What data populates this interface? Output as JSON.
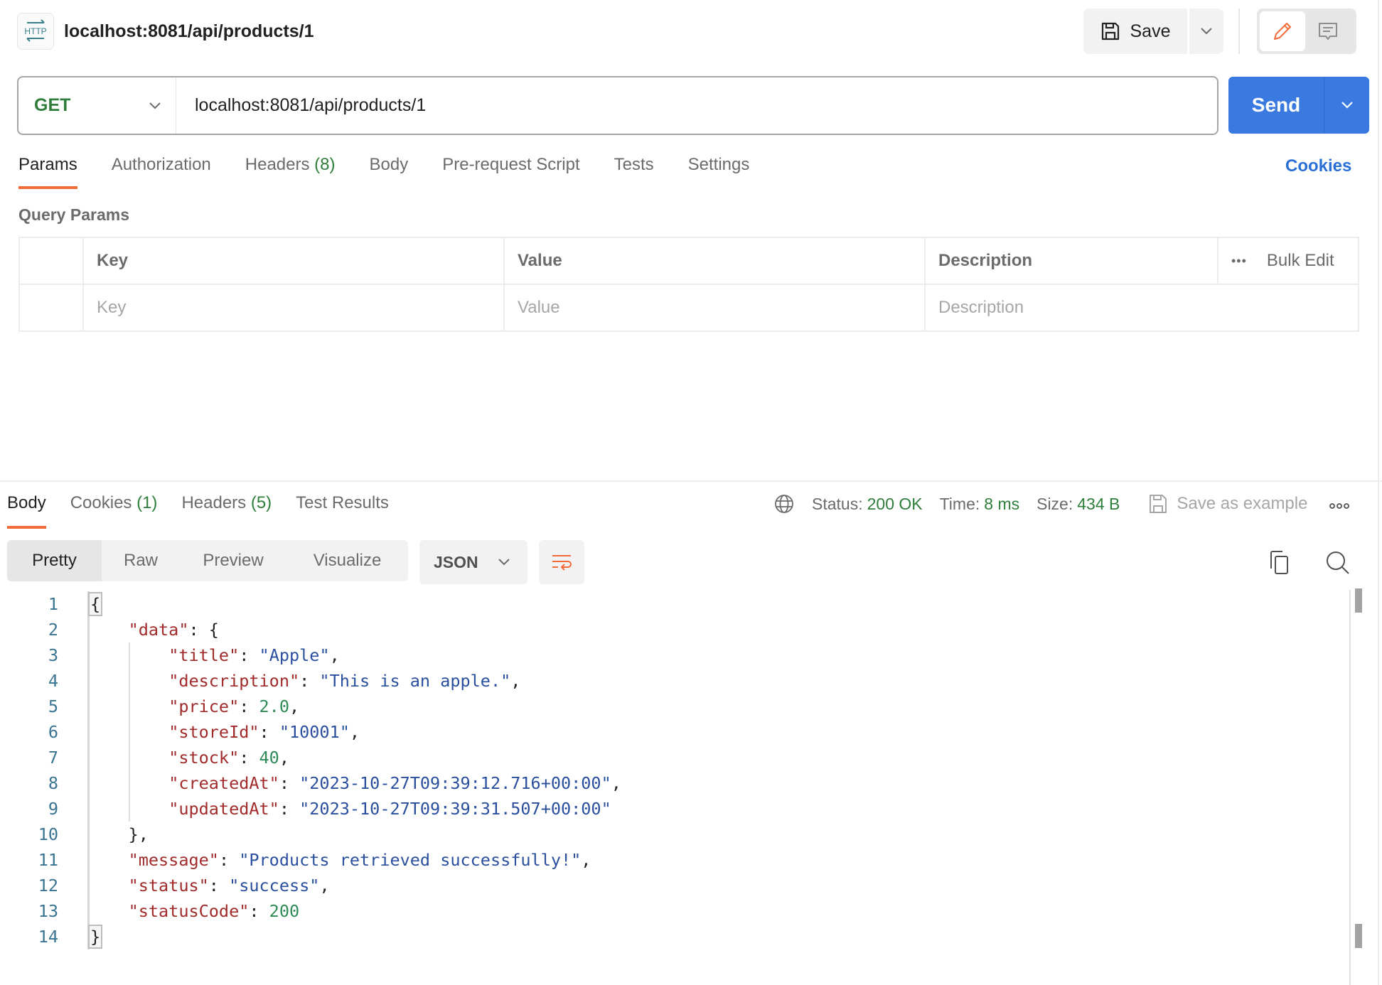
{
  "header": {
    "icon_label": "HTTP",
    "title": "localhost:8081/api/products/1",
    "save_label": "Save"
  },
  "request": {
    "method": "GET",
    "url": "localhost:8081/api/products/1",
    "send_label": "Send",
    "tabs": [
      {
        "label": "Params",
        "count": ""
      },
      {
        "label": "Authorization",
        "count": ""
      },
      {
        "label": "Headers",
        "count": "(8)"
      },
      {
        "label": "Body",
        "count": ""
      },
      {
        "label": "Pre-request Script",
        "count": ""
      },
      {
        "label": "Tests",
        "count": ""
      },
      {
        "label": "Settings",
        "count": ""
      }
    ],
    "cookies_label": "Cookies",
    "query_params_label": "Query Params",
    "table": {
      "headers": [
        "Key",
        "Value",
        "Description"
      ],
      "bulk_edit_label": "Bulk Edit",
      "placeholders": {
        "key": "Key",
        "value": "Value",
        "description": "Description"
      }
    }
  },
  "response": {
    "tabs": [
      {
        "label": "Body",
        "count": ""
      },
      {
        "label": "Cookies",
        "count": "(1)"
      },
      {
        "label": "Headers",
        "count": "(5)"
      },
      {
        "label": "Test Results",
        "count": ""
      }
    ],
    "status_label": "Status:",
    "status_value": "200 OK",
    "time_label": "Time:",
    "time_value": "8 ms",
    "size_label": "Size:",
    "size_value": "434 B",
    "save_example_label": "Save as example",
    "view_modes": [
      "Pretty",
      "Raw",
      "Preview",
      "Visualize"
    ],
    "active_view": "Pretty",
    "format": "JSON",
    "line_numbers": [
      "1",
      "2",
      "3",
      "4",
      "5",
      "6",
      "7",
      "8",
      "9",
      "10",
      "11",
      "12",
      "13",
      "14"
    ],
    "body": {
      "title": "Apple",
      "description": "This is an apple.",
      "price": "2.0",
      "storeId": "10001",
      "stock": "40",
      "createdAt": "2023-10-27T09:39:12.716+00:00",
      "updatedAt": "2023-10-27T09:39:31.507+00:00",
      "message": "Products retrieved successfully!",
      "status": "success",
      "statusCode": "200"
    }
  },
  "colors": {
    "accent_orange": "#f26b3a",
    "send_blue": "#3a7ae0",
    "method_green": "#2f7d3b",
    "link_blue": "#2a6fd6"
  }
}
